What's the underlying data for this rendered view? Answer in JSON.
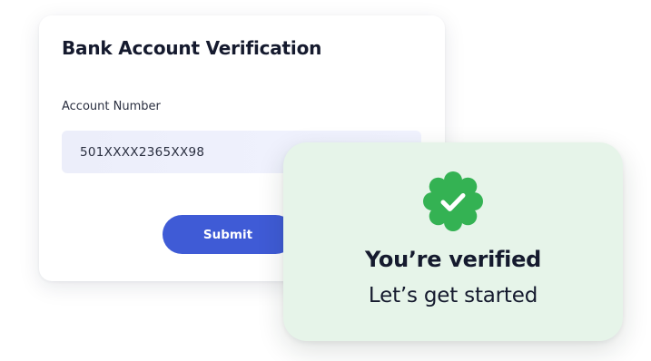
{
  "bank_form": {
    "title": "Bank Account Verification",
    "account_label": "Account Number",
    "account_value": "501XXXX2365XX98",
    "submit_label": "Submit"
  },
  "verified": {
    "icon": "verified-badge-check-icon",
    "title": "You’re verified",
    "subtitle": "Let’s get started"
  },
  "colors": {
    "primary_button": "#3f5bd6",
    "success_green": "#34b253",
    "success_bg": "#e6f4e9",
    "input_bg": "#eceefa",
    "text_dark": "#151a2e"
  }
}
